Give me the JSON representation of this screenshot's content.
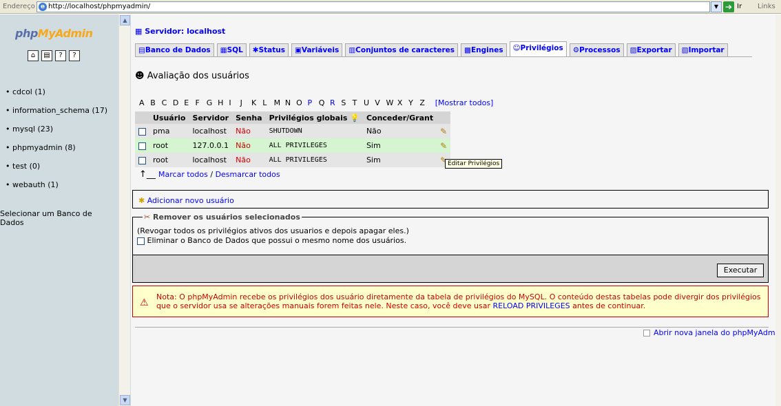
{
  "browser": {
    "address_label": "Endereço",
    "url": "http://localhost/phpmyadmin/",
    "go_label": "Ir",
    "links_label": "Links"
  },
  "sidebar": {
    "logo_php": "php",
    "logo_my": "My",
    "logo_admin": "Admin",
    "databases": [
      {
        "label": "cdcol (1)"
      },
      {
        "label": "information_schema (17)"
      },
      {
        "label": "mysql (23)"
      },
      {
        "label": "phpmyadmin (8)"
      },
      {
        "label": "test (0)"
      },
      {
        "label": "webauth (1)"
      }
    ],
    "select_db_label": "Selecionar um Banco de Dados"
  },
  "header": {
    "server_label": "Servidor: localhost"
  },
  "tabs": [
    {
      "label": "Banco de Dados"
    },
    {
      "label": "SQL"
    },
    {
      "label": "Status"
    },
    {
      "label": "Variáveis"
    },
    {
      "label": "Conjuntos de caracteres"
    },
    {
      "label": "Engines"
    },
    {
      "label": "Privilégios",
      "active": true
    },
    {
      "label": "Processos"
    },
    {
      "label": "Exportar"
    },
    {
      "label": "Importar"
    }
  ],
  "main": {
    "title": "Avaliação dos usuários",
    "alphabet": [
      "A",
      "B",
      "C",
      "D",
      "E",
      "F",
      "G",
      "H",
      "I",
      "J",
      "K",
      "L",
      "M",
      "N",
      "O",
      "P",
      "Q",
      "R",
      "S",
      "T",
      "U",
      "V",
      "W",
      "X",
      "Y",
      "Z"
    ],
    "show_all": "[Mostrar todos]",
    "table": {
      "headers": [
        "Usuário",
        "Servidor",
        "Senha",
        "Privilégios globais",
        "Conceder/Grant"
      ],
      "rows": [
        {
          "user": "pma",
          "host": "localhost",
          "password": "Não",
          "privileges": "SHUTDOWN",
          "grant": "Não"
        },
        {
          "user": "root",
          "host": "127.0.0.1",
          "password": "Não",
          "privileges": "ALL PRIVILEGES",
          "grant": "Sim"
        },
        {
          "user": "root",
          "host": "localhost",
          "password": "Não",
          "privileges": "ALL PRIVILEGES",
          "grant": "Sim"
        }
      ]
    },
    "tooltip": "Editar Privilégios",
    "check_all": "Marcar todos",
    "separator": "/",
    "uncheck_all": "Desmarcar todos",
    "add_user": "Adicionar novo usuário",
    "remove": {
      "legend": "Remover os usuários selecionados",
      "description": "(Revogar todos os privilégios ativos dos usuarios e depois apagar eles.)",
      "drop_db_label": "Eliminar o Banco de Dados que possui o mesmo nome dos usuários.",
      "execute": "Executar"
    },
    "note": {
      "text_before": "Nota: O phpMyAdmin recebe os privilégios dos usuário diretamente da tabela de privilégios do MySQL. O conteúdo destas tabelas pode divergir dos privilégios que o servidor usa se alterações manuais forem feitas nele. Neste caso, você deve usar ",
      "link": "RELOAD PRIVILEGES",
      "text_after": " antes de continuar."
    },
    "new_window": "Abrir nova janela do phpMyAdmin"
  }
}
